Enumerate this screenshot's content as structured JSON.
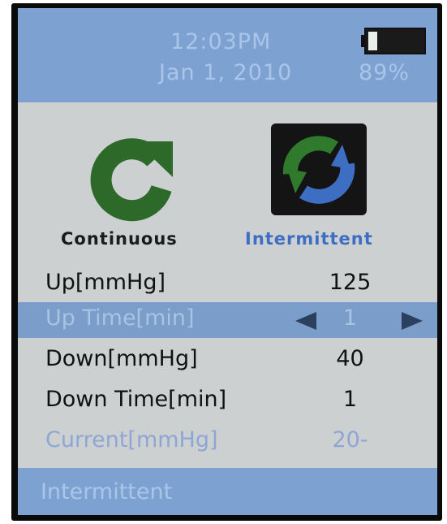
{
  "status": {
    "time": "12:03PM",
    "date": "Jan 1, 2010",
    "battery_percent": "89%",
    "battery_level": 0.15
  },
  "modes": {
    "continuous_label": "Continuous",
    "intermittent_label": "Intermittent",
    "selected": "Intermittent"
  },
  "settings": [
    {
      "label": "Up[mmHg]",
      "value": "125"
    },
    {
      "label": "Up Time[min]",
      "value": "1"
    },
    {
      "label": "Down[mmHg]",
      "value": "40"
    },
    {
      "label": "Down Time[min]",
      "value": "1"
    },
    {
      "label": "Current[mmHg]",
      "value": "20-"
    }
  ],
  "footer": {
    "mode_text": "Intermittent"
  },
  "colors": {
    "header_bg": "#7da1d0",
    "screen_bg": "#ccd0d1",
    "continuous_green": "#2d6a2a",
    "intermittent_blue": "#3d6ec4"
  }
}
